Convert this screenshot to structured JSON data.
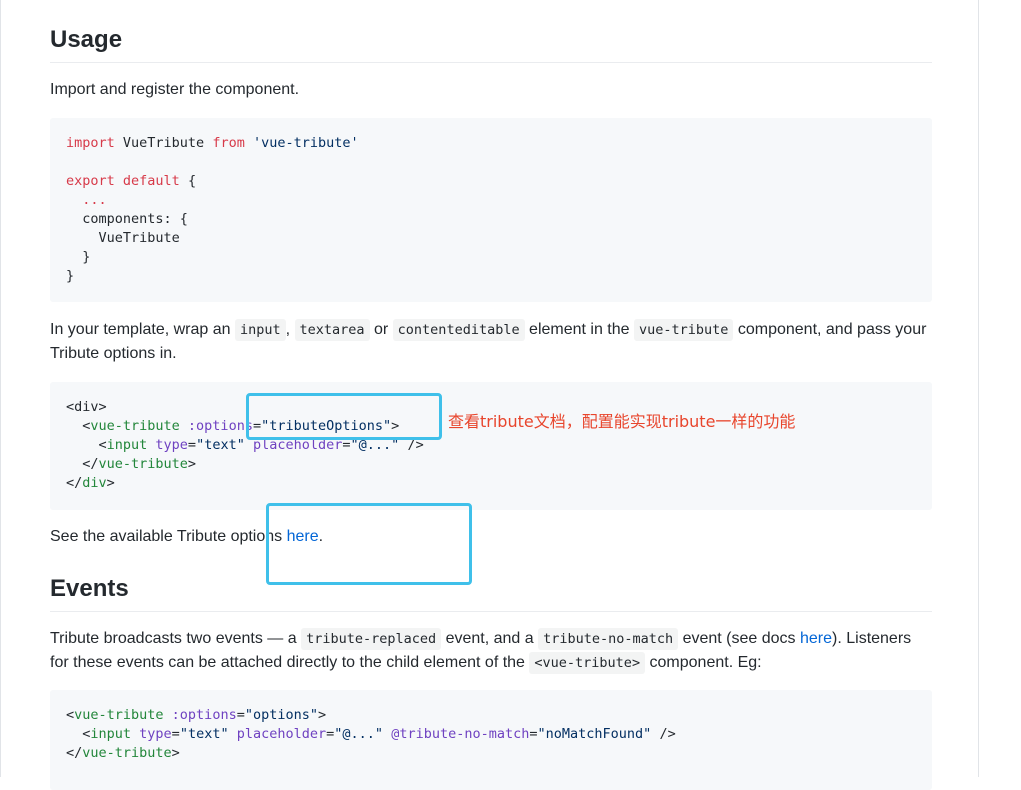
{
  "usage": {
    "heading": "Usage",
    "intro": "Import and register the component.",
    "code1": {
      "l1_kw": "import",
      "l1_name": " VueTribute ",
      "l1_from": "from",
      "l1_str": " 'vue-tribute'",
      "l3_kw": "export",
      "l3_kw2": " default",
      "l3_rest": " {",
      "l4": "  ...",
      "l5": "  components: {",
      "l6": "    VueTribute",
      "l7": "  }",
      "l8": "}"
    },
    "para2": {
      "t1": "In your template, wrap an ",
      "c1": "input",
      "t2": ", ",
      "c2": "textarea",
      "t3": " or ",
      "c3": "contenteditable",
      "t4": " element in the ",
      "c4": "vue-tribute",
      "t5": " component, and pass your Tribute options in."
    },
    "code2": {
      "l1": "<div>",
      "l2_open": "  <",
      "l2_tag": "vue-tribute",
      "l2_attr": " :options",
      "l2_eq": "=",
      "l2_val": "\"tributeOptions\"",
      "l2_close": ">",
      "l3_open": "    <",
      "l3_tag": "input",
      "l3_attr1": " type",
      "l3_eq1": "=",
      "l3_val1": "\"text\"",
      "l3_attr2": " placeholder",
      "l3_eq2": "=",
      "l3_val2": "\"@...\"",
      "l3_close": " />",
      "l4_open": "  </",
      "l4_tag": "vue-tribute",
      "l4_close": ">",
      "l5_open": "</",
      "l5_tag": "div",
      "l5_close": ">"
    },
    "para3": {
      "t1": "See the available Tribute options ",
      "link": "here",
      "t2": "."
    }
  },
  "events": {
    "heading": "Events",
    "para": {
      "t1": "Tribute broadcasts two events — a ",
      "c1": "tribute-replaced",
      "t2": " event, and a ",
      "c2": "tribute-no-match",
      "t3": " event (see docs ",
      "link": "here",
      "t4": "). Listeners for these events can be attached directly to the child element of the ",
      "c3": "<vue-tribute>",
      "t5": " component. Eg:"
    },
    "code3": {
      "l1_open": "<",
      "l1_tag": "vue-tribute",
      "l1_attr": " :options",
      "l1_eq": "=",
      "l1_val": "\"options\"",
      "l1_close": ">",
      "l2_open": "  <",
      "l2_tag": "input",
      "l2_attr1": " type",
      "l2_eq1": "=",
      "l2_val1": "\"text\"",
      "l2_attr2": " placeholder",
      "l2_eq2": "=",
      "l2_val2": "\"@...\"",
      "l2_attr3": " @tribute-no-match",
      "l2_eq3": "=",
      "l2_val3": "\"noMatchFound\"",
      "l2_close": " />",
      "l3_open": "</",
      "l3_tag": "vue-tribute",
      "l3_close": ">"
    }
  },
  "annotation": {
    "text": "查看tribute文档，配置能实现tribute一样的功能",
    "color": "#e8452c",
    "box_color": "#3fc0ea"
  }
}
